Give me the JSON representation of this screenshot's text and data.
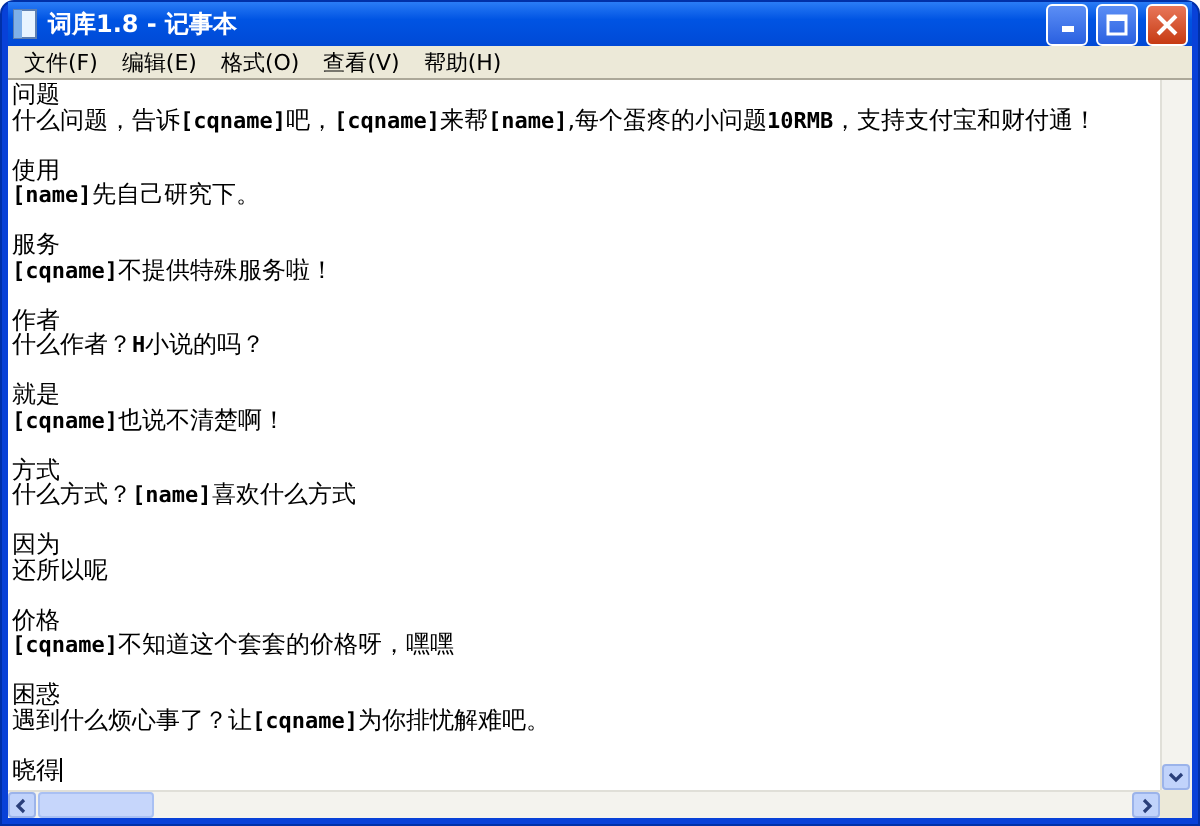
{
  "window": {
    "title": "词库1.8 - 记事本"
  },
  "menu": [
    "文件(F)",
    "编辑(E)",
    "格式(O)",
    "查看(V)",
    "帮助(H)"
  ],
  "paragraphs": [
    {
      "heading": "问题",
      "body": "什么问题，告诉**[cqname]**吧，**[cqname]**来帮**[name]**,每个蛋疼的小问题**10RMB**，支持支付宝和财付通！"
    },
    {
      "heading": "使用",
      "body": "**[name]**先自己研究下。"
    },
    {
      "heading": "服务",
      "body": "**[cqname]**不提供特殊服务啦！"
    },
    {
      "heading": "作者",
      "body": "什么作者？**H**小说的吗？"
    },
    {
      "heading": "就是",
      "body": "**[cqname]**也说不清楚啊！"
    },
    {
      "heading": "方式",
      "body": "什么方式？**[name]**喜欢什么方式"
    },
    {
      "heading": "因为",
      "body": "还所以呢"
    },
    {
      "heading": "价格",
      "body": "**[cqname]**不知道这个套套的价格呀，嘿嘿"
    },
    {
      "heading": "困惑",
      "body": "遇到什么烦心事了？让**[cqname]**为你排忧解难吧。"
    },
    {
      "heading": "晓得"
    }
  ]
}
